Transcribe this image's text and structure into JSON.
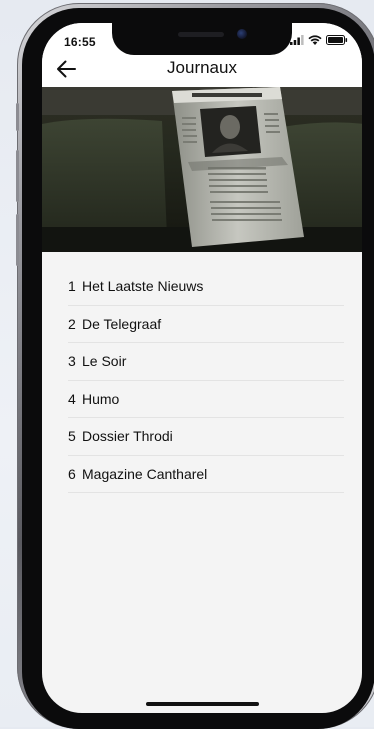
{
  "status_bar": {
    "time": "16:55"
  },
  "header": {
    "back_icon": "arrow-left-icon",
    "title": "Journaux"
  },
  "banner": {
    "description_icon": "newspaper-photo"
  },
  "journals": [
    {
      "number": "1",
      "name": "Het Laatste Nieuws"
    },
    {
      "number": "2",
      "name": "De Telegraaf"
    },
    {
      "number": "3",
      "name": "Le Soir"
    },
    {
      "number": "4",
      "name": "Humo"
    },
    {
      "number": "5",
      "name": "Dossier Throdi"
    },
    {
      "number": "6",
      "name": "Magazine Cantharel"
    }
  ],
  "colors": {
    "screen_bg": "#f4f4f4",
    "header_bg": "#ffffff",
    "text": "#111111",
    "divider": "#e3e3e3"
  }
}
